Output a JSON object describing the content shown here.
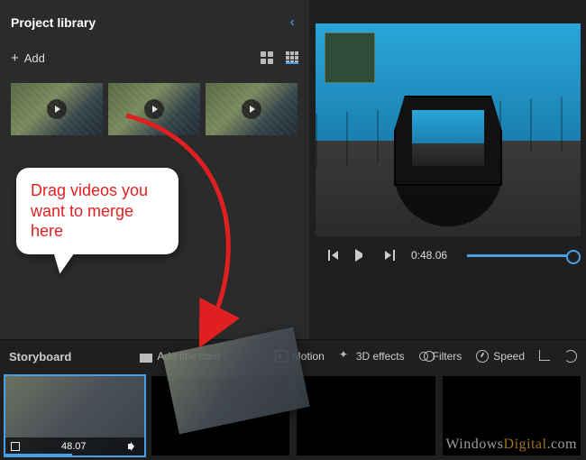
{
  "library": {
    "title": "Project library",
    "add_label": "Add"
  },
  "preview": {
    "time": "0:48.06"
  },
  "storyboard": {
    "title": "Storyboard",
    "add_title_card": "Add title card",
    "tools": {
      "motion": "Motion",
      "effects": "3D effects",
      "filters": "Filters",
      "speed": "Speed"
    },
    "clip_duration": "48.07"
  },
  "callout": {
    "text": "Drag videos you want to merge here"
  },
  "watermark": {
    "brand_a": "Windows",
    "brand_b": "Digital",
    "suffix": ".com"
  }
}
